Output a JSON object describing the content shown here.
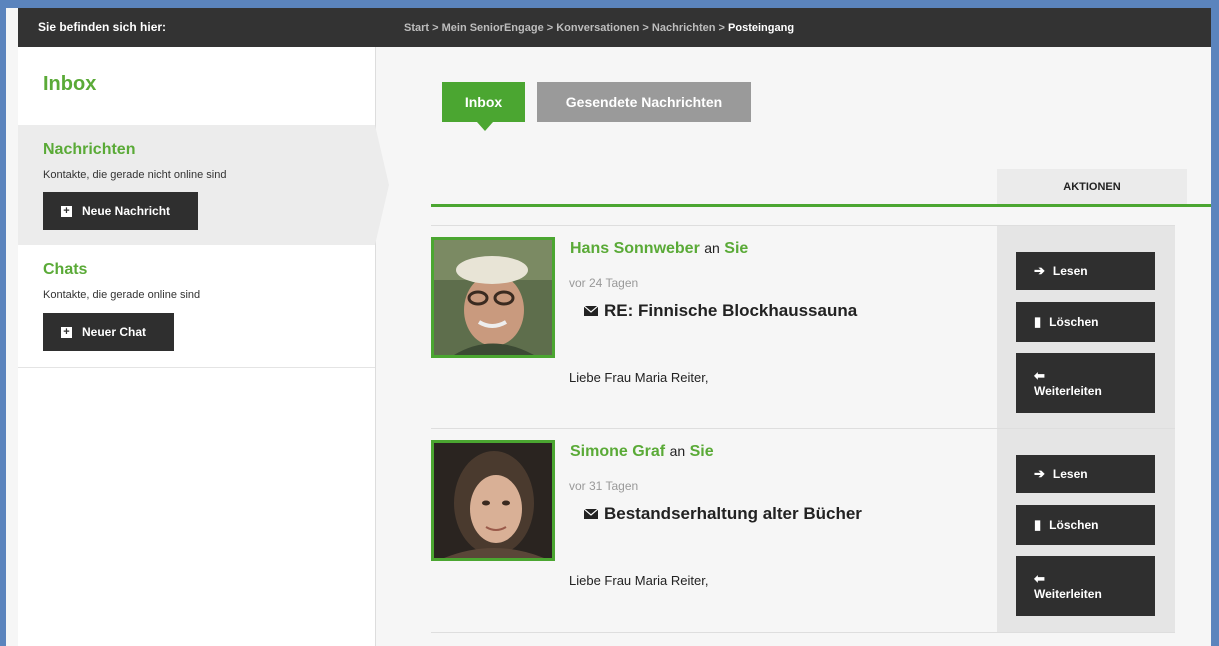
{
  "breadcrumb": {
    "label": "Sie befinden sich hier:",
    "items": [
      "Start",
      "Mein SeniorEngage",
      "Konversationen",
      "Nachrichten",
      "Posteingang"
    ]
  },
  "sidebar": {
    "title": "Inbox",
    "nachrichten": {
      "title": "Nachrichten",
      "desc": "Kontakte, die gerade nicht online sind",
      "button": "Neue Nachricht"
    },
    "chats": {
      "title": "Chats",
      "desc": "Kontakte, die gerade online sind",
      "button": "Neuer Chat"
    }
  },
  "tabs": {
    "inbox": "Inbox",
    "sent": "Gesendete Nachrichten"
  },
  "table": {
    "actions_header": "AKTIONEN"
  },
  "messages": [
    {
      "sender": "Hans Sonnweber",
      "to_word": "an",
      "recipient": "Sie",
      "age": "vor 24 Tagen",
      "subject": "RE: Finnische Blockhaussauna",
      "preview": "Liebe Frau Maria Reiter,"
    },
    {
      "sender": "Simone Graf",
      "to_word": "an",
      "recipient": "Sie",
      "age": "vor 31 Tagen",
      "subject": "Bestandserhaltung alter Bücher",
      "preview": "Liebe Frau Maria Reiter,"
    }
  ],
  "action_labels": {
    "read": "Lesen",
    "delete": "Löschen",
    "forward": "Weiterleiten"
  },
  "colors": {
    "accent": "#4ba631",
    "dark": "#2f2f2f",
    "topbar": "#333333"
  }
}
